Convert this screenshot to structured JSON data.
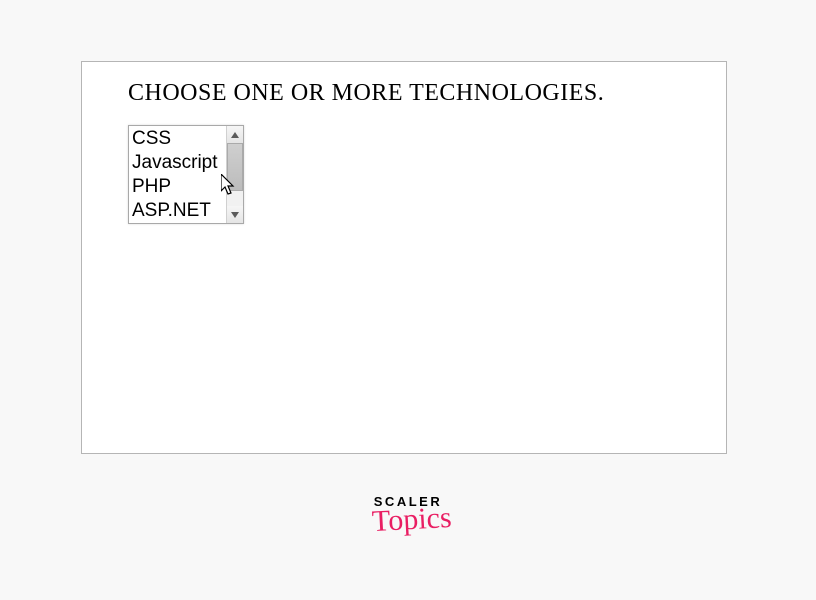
{
  "heading": "CHOOSE ONE OR MORE TECHNOLOGIES.",
  "listbox": {
    "items": [
      "CSS",
      "Javascript",
      "PHP",
      "ASP.NET"
    ]
  },
  "logo": {
    "line1": "SCALER",
    "line2": "Topics"
  }
}
